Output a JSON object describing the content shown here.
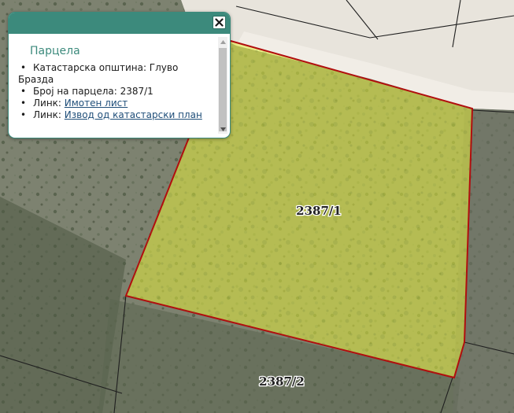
{
  "popup": {
    "title": "Парцела",
    "items": [
      {
        "label": "Катастарска општина: Глуво Бразда"
      },
      {
        "label": "Број на парцела: 2387/1"
      },
      {
        "label": "Линк: ",
        "link_text": "Имотен лист"
      },
      {
        "label": "Линк: ",
        "link_text": "Извод од катастарски план"
      }
    ],
    "close_icon": "close-icon"
  },
  "map": {
    "parcels": [
      {
        "id": "2387/1",
        "selected": true
      },
      {
        "id": "2387/2",
        "selected": false
      }
    ],
    "colors": {
      "selected_fill": "#e3ec3c",
      "selected_outline": "#b10e0e",
      "boundary": "#1f1f1f",
      "label": "#222222",
      "popup_accent": "#3c8a7c"
    }
  }
}
